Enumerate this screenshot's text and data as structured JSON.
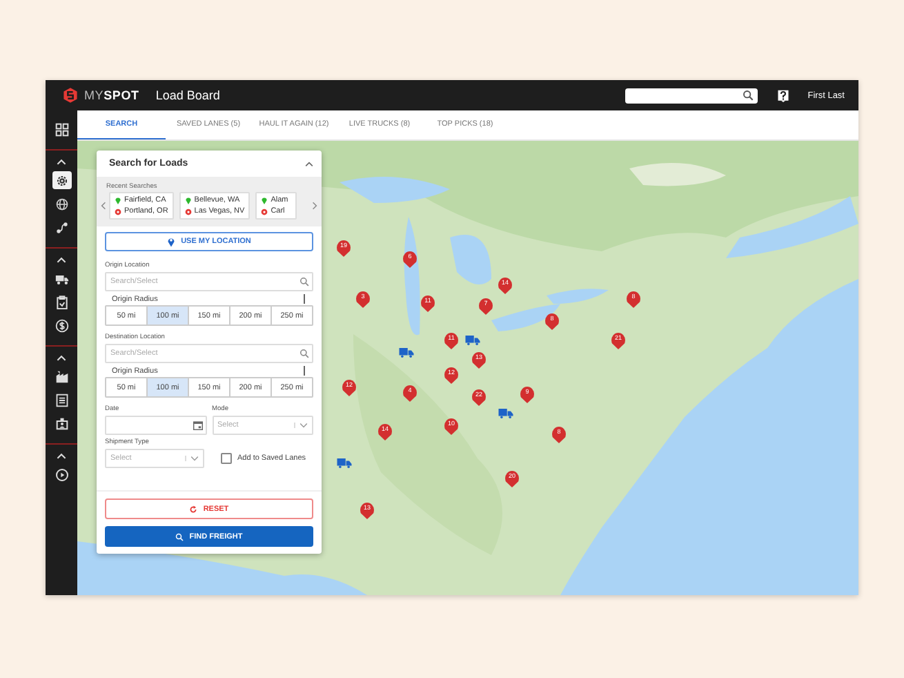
{
  "header": {
    "logo": "MY**SPOT**",
    "title": "Load Board",
    "user": "First Last"
  },
  "sidebar": {
    "groups": [
      {
        "items": [
          {
            "selected": false
          }
        ]
      },
      {
        "items": [
          {
            "selected": true
          },
          {
            "selected": false
          },
          {
            "selected": false
          }
        ]
      },
      {
        "items": [
          {
            "selected": false
          },
          {
            "selected": false
          },
          {
            "selected": false
          }
        ]
      },
      {
        "items": [
          {
            "selected": false
          },
          {
            "selected": false
          },
          {
            "selected": false
          }
        ]
      },
      {
        "items": [
          {
            "selected": false
          }
        ]
      }
    ]
  },
  "tabs": [
    {
      "label": "SEARCH",
      "selected": true
    },
    {
      "label": "SAVED LANES (5)",
      "selected": false
    },
    {
      "label": "HAUL IT AGAIN (12)",
      "selected": false
    },
    {
      "label": "LIVE TRUCKS (8)",
      "selected": false
    },
    {
      "label": "TOP PICKS (18)",
      "selected": false
    }
  ],
  "panel": {
    "title": "Search for Loads",
    "recent_label": "Recent Searches",
    "recent": [
      {
        "origin": "Fairfield, CA",
        "destination": "Portland, OR"
      },
      {
        "origin": "Bellevue, WA",
        "destination": "Las Vegas, NV"
      },
      {
        "origin": "Alam",
        "destination": "Carl"
      }
    ],
    "use_location": "USE MY LOCATION",
    "origin": {
      "label": "Origin Location",
      "placeholder": "Search/Select",
      "radius_label": "Origin Radius",
      "radius": [
        {
          "label": "50 mi",
          "selected": false
        },
        {
          "label": "100 mi",
          "selected": true
        },
        {
          "label": "150 mi",
          "selected": false
        },
        {
          "label": "200 mi",
          "selected": false
        },
        {
          "label": "250 mi",
          "selected": false
        }
      ]
    },
    "destination": {
      "label": "Destination Location",
      "placeholder": "Search/Select",
      "radius_label": "Origin Radius",
      "radius": [
        {
          "label": "50 mi",
          "selected": false
        },
        {
          "label": "100 mi",
          "selected": true
        },
        {
          "label": "150 mi",
          "selected": false
        },
        {
          "label": "200 mi",
          "selected": false
        },
        {
          "label": "250 mi",
          "selected": false
        }
      ]
    },
    "date": {
      "label": "Date"
    },
    "mode": {
      "label": "Mode",
      "placeholder": "Select"
    },
    "shipment_type": {
      "label": "Shipment Type",
      "placeholder": "Select"
    },
    "save_lane": {
      "label": "Add to Saved Lanes",
      "checked": false
    },
    "reset": "RESET",
    "find": "FIND FREIGHT"
  },
  "map": {
    "kind": "picture",
    "markers": [
      {
        "count": "19"
      },
      {
        "count": "6"
      },
      {
        "count": "3"
      },
      {
        "count": "11"
      },
      {
        "count": "7"
      },
      {
        "count": "14"
      },
      {
        "count": "8"
      },
      {
        "count": "8"
      },
      {
        "count": "21"
      },
      {
        "count": "11"
      },
      {
        "count": "13"
      },
      {
        "count": "12"
      },
      {
        "count": "12"
      },
      {
        "count": "4"
      },
      {
        "count": "22"
      },
      {
        "count": "9"
      },
      {
        "count": "14"
      },
      {
        "count": "10"
      },
      {
        "count": "8"
      },
      {
        "count": "20"
      },
      {
        "count": "13"
      }
    ]
  }
}
